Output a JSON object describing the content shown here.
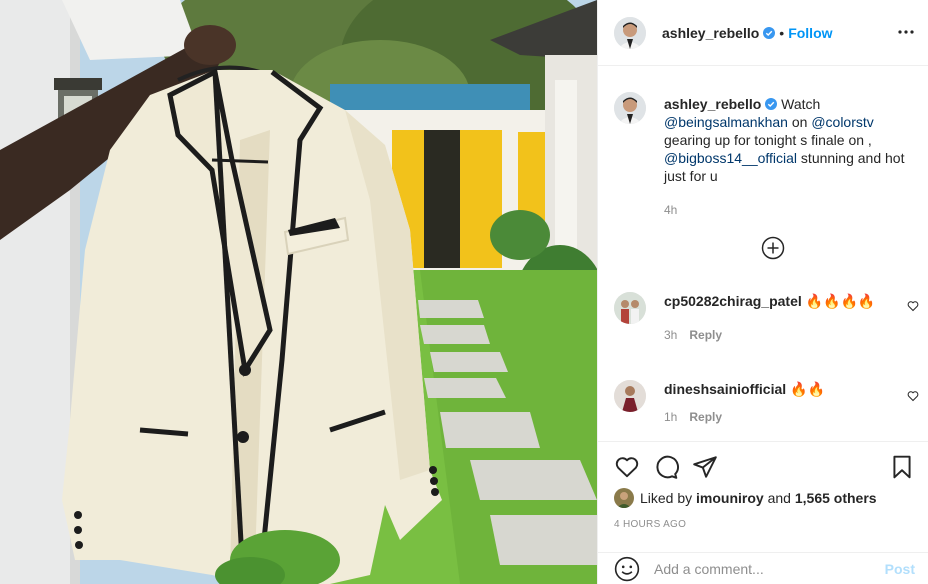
{
  "post": {
    "author": "ashley_rebello",
    "follow_label": "Follow",
    "dot": "•",
    "caption": {
      "user": "ashley_rebello",
      "part1": "Watch ",
      "mention1": "@beingsalmankhan",
      "part2": " on ",
      "mention2": "@colorstv",
      "part3": " gearing up for tonight s finale on , ",
      "mention3": "@bigboss14__official",
      "part4": " stunning and hot just for u",
      "time": "4h"
    },
    "comments": [
      {
        "user": "cp50282chirag_patel",
        "text": "🔥🔥🔥🔥",
        "time": "3h",
        "reply": "Reply"
      },
      {
        "user": "dineshsainiofficial",
        "text": "🔥🔥",
        "time": "1h",
        "reply": "Reply"
      }
    ],
    "likes": {
      "prefix": "Liked by ",
      "user": "imouniroy",
      "middle": " and ",
      "others": "1,565 others"
    },
    "posted_ago": "4 HOURS AGO",
    "add_comment_placeholder": "Add a comment...",
    "post_button": "Post"
  },
  "icons": {
    "verified": "verified-badge-icon",
    "more": "more-options-icon",
    "load_more": "plus-circle-icon",
    "like": "heart-icon",
    "comment": "comment-icon",
    "share": "share-icon",
    "save": "bookmark-icon",
    "emoji": "emoji-icon"
  },
  "colors": {
    "link": "#0095f6",
    "mention": "#00376b",
    "muted": "#8e8e8e",
    "post_disabled": "#b2dffc",
    "border": "#efefef"
  }
}
